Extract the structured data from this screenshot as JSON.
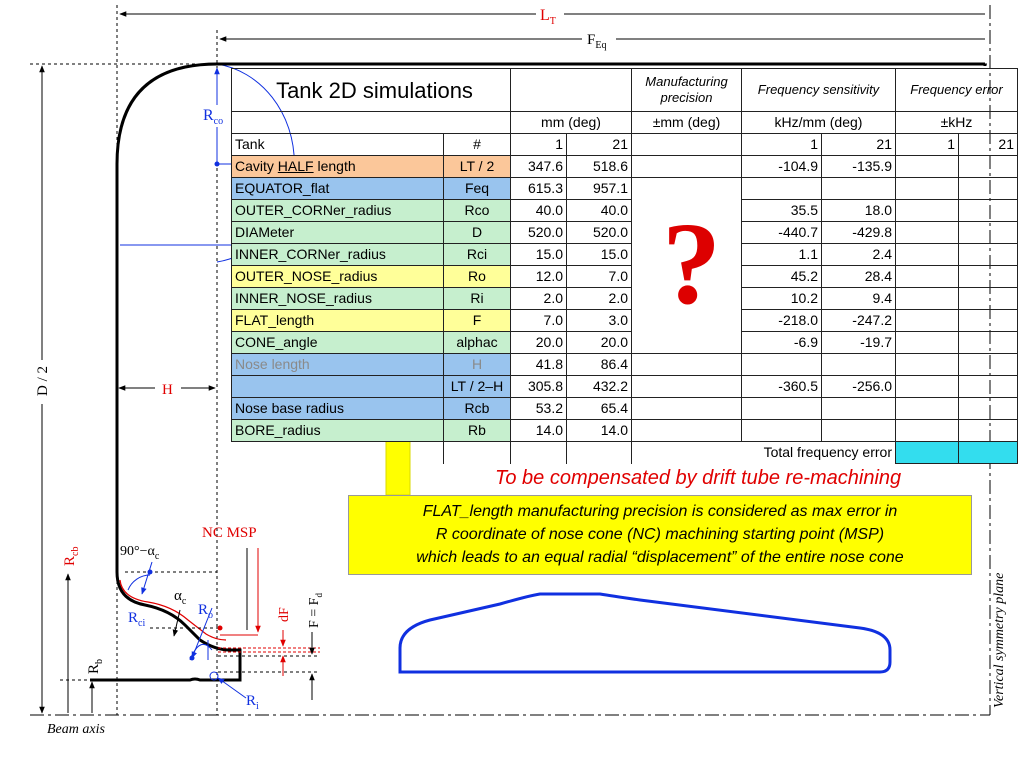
{
  "diagram": {
    "labels": {
      "lt": "L",
      "lt_sub": "T",
      "feq": "F",
      "feq_sub": "Eq",
      "rco": "R",
      "rco_sub": "co",
      "d2": "D / 2",
      "h": "H",
      "rcb": "R",
      "rcb_sub": "cb",
      "ninety": "90°−α",
      "ninety_sub": "c",
      "nc_msp": "NC MSP",
      "alpha": "α",
      "alpha_sub": "c",
      "ro": "R",
      "ro_sub": "o",
      "rci": "R",
      "rci_sub": "ci",
      "df": "dF",
      "f_fd": "F = F",
      "f_fd_sub": "d",
      "rb": "R",
      "rb_sub": "b",
      "ri": "R",
      "ri_sub": "i",
      "beam_axis": "Beam axis",
      "vsym": "Vertical symmetry plane"
    },
    "colors": {
      "red": "#e00000",
      "blue": "#1030e0",
      "black": "#000000",
      "yellow": "#ffff00"
    }
  },
  "table": {
    "title": "Tank 2D simulations",
    "header": {
      "manufacturing": "Manufacturing precision",
      "freq_sens": "Frequency sensitivity",
      "freq_err": "Frequency error",
      "units_mm": "mm (deg)",
      "units_pm_mm": "±mm (deg)",
      "units_khz_mm": "kHz/mm (deg)",
      "units_pm_khz": "±kHz"
    },
    "tank_row": {
      "name": "Tank",
      "sym": "#",
      "v1": "1",
      "v2": "21",
      "s1": "1",
      "s2": "21",
      "e1": "1",
      "e2": "21"
    },
    "cavity_row": {
      "pre": "Cavity ",
      "half": "HALF",
      "post": " length",
      "sym": "LT / 2",
      "v1": "347.6",
      "v2": "518.6",
      "s1": "-104.9",
      "s2": "-135.9"
    },
    "rows": [
      {
        "name": "EQUATOR_flat",
        "sym": "Feq",
        "v1": "615.3",
        "v2": "957.1",
        "s1": "",
        "s2": ""
      },
      {
        "name": "OUTER_CORNer_radius",
        "sym": "Rco",
        "v1": "40.0",
        "v2": "40.0",
        "s1": "35.5",
        "s2": "18.0"
      },
      {
        "name": "DIAMeter",
        "sym": "D",
        "v1": "520.0",
        "v2": "520.0",
        "s1": "-440.7",
        "s2": "-429.8"
      },
      {
        "name": "INNER_CORNer_radius",
        "sym": "Rci",
        "v1": "15.0",
        "v2": "15.0",
        "s1": "1.1",
        "s2": "2.4"
      },
      {
        "name": "OUTER_NOSE_radius",
        "sym": "Ro",
        "v1": "12.0",
        "v2": "7.0",
        "s1": "45.2",
        "s2": "28.4"
      },
      {
        "name": "INNER_NOSE_radius",
        "sym": "Ri",
        "v1": "2.0",
        "v2": "2.0",
        "s1": "10.2",
        "s2": "9.4"
      },
      {
        "name": "FLAT_length",
        "sym": "F",
        "v1": "7.0",
        "v2": "3.0",
        "s1": "-218.0",
        "s2": "-247.2"
      },
      {
        "name": "CONE_angle",
        "sym": "alphac",
        "v1": "20.0",
        "v2": "20.0",
        "s1": "-6.9",
        "s2": "-19.7"
      },
      {
        "name": "Nose length",
        "sym": "H",
        "v1": "41.8",
        "v2": "86.4",
        "s1": "",
        "s2": ""
      },
      {
        "name": "",
        "sym": "LT / 2–H",
        "v1": "305.8",
        "v2": "432.2",
        "s1": "-360.5",
        "s2": "-256.0"
      },
      {
        "name": "Nose base radius",
        "sym": "Rcb",
        "v1": "53.2",
        "v2": "65.4",
        "s1": "",
        "s2": ""
      },
      {
        "name": "BORE_radius",
        "sym": "Rb",
        "v1": "14.0",
        "v2": "14.0",
        "s1": "",
        "s2": ""
      }
    ],
    "total_label": "Total frequency error",
    "question_mark": "?"
  },
  "compensate_text": "To be compensated by drift tube re-machining",
  "callout": {
    "line1": "FLAT_length manufacturing precision is considered as max error in",
    "line2": "R coordinate of nose cone (NC) machining starting point (MSP)",
    "line3": "which leads to an equal radial “displacement” of the entire nose cone"
  }
}
